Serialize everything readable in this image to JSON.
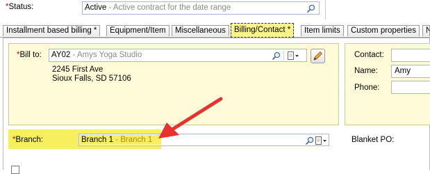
{
  "status": {
    "label": "Status:",
    "value": "Active",
    "value_description": " - Active contract for the date range"
  },
  "tabs": [
    {
      "label": "Installment based billing *"
    },
    {
      "label": "Equipment/Item"
    },
    {
      "label": "Miscellaneous"
    },
    {
      "label": "Billing/Contact *",
      "active": true
    },
    {
      "label": "Item limits"
    },
    {
      "label": "Custom properties"
    },
    {
      "label": "N"
    }
  ],
  "bill_to": {
    "label": "Bill to:",
    "value": "AY02",
    "value_description": " - Amys Yoga Studio",
    "address_line1": "2245 First Ave",
    "address_line2": "Sioux Falls, SD 57106"
  },
  "contact": {
    "contact_label": "Contact:",
    "name_label": "Name:",
    "name_value": "Amy",
    "phone_label": "Phone:"
  },
  "branch": {
    "label": "Branch:",
    "value": "Branch 1",
    "value_description": " - Branch 1"
  },
  "blanket_po": {
    "label": "Blanket PO:"
  },
  "colors": {
    "highlight": "#f7ef5e",
    "arrow": "#e8322e",
    "panel_bg": "#fffbd9"
  }
}
